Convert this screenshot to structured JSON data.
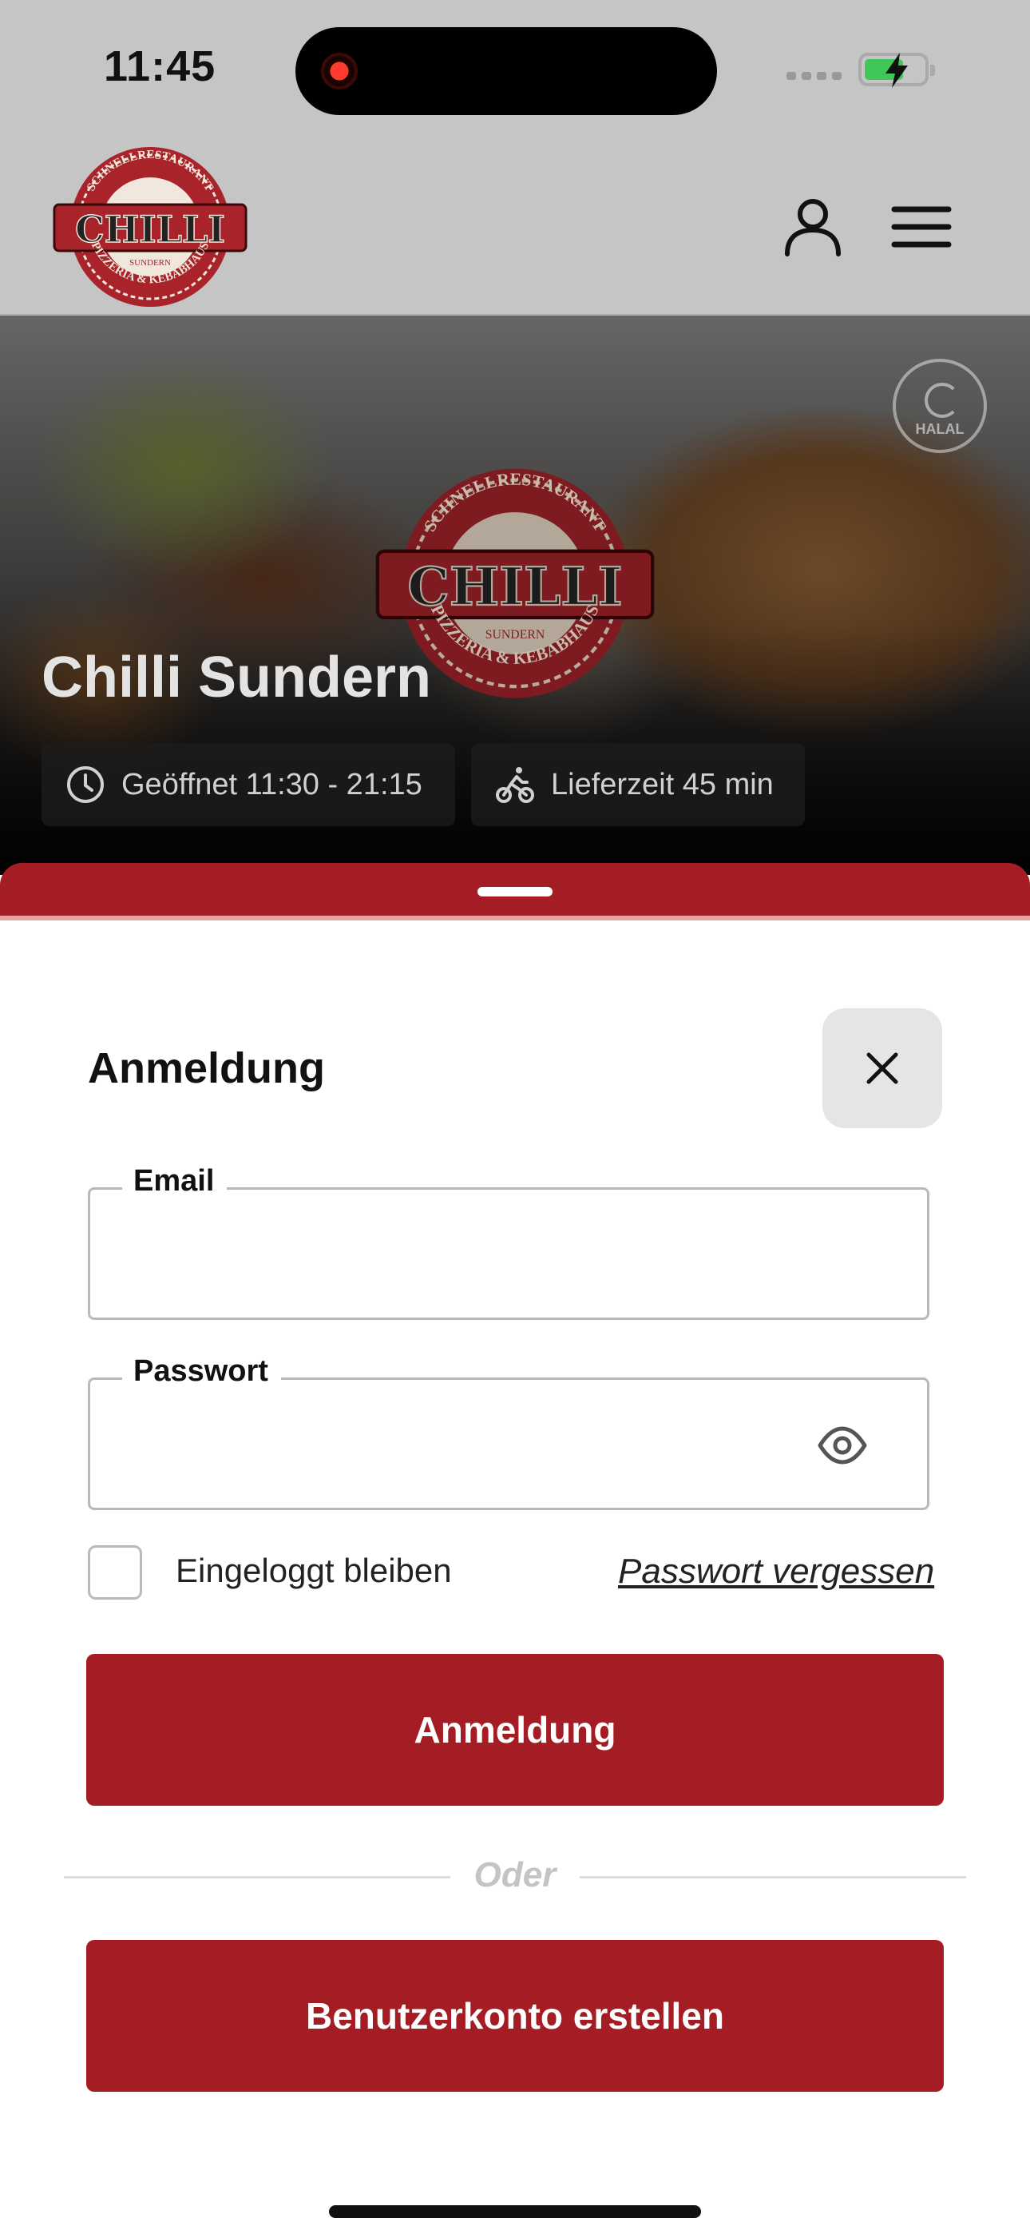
{
  "status_bar": {
    "time": "11:45",
    "recording_indicator": "red",
    "battery": {
      "charging": true,
      "level_fraction": 0.55,
      "color": "#40c759"
    }
  },
  "header": {
    "logo": {
      "top_text": "SCHNELLRESTAURANT",
      "main_text": "CHILLI",
      "middle_text": "SUNDERN",
      "bottom_text": "PIZZERIA & KEBABHAUS"
    },
    "icons": [
      "user-icon",
      "hamburger-menu-icon"
    ]
  },
  "hero": {
    "title": "Chilli Sundern",
    "badge_text": "HALAL",
    "opening_hours": "Geöffnet 11:30 - 21:15",
    "delivery_time": "Lieferzeit 45 min"
  },
  "login": {
    "title": "Anmeldung",
    "email_label": "Email",
    "email_value": "",
    "password_label": "Passwort",
    "password_value": "",
    "remember_label": "Eingeloggt bleiben",
    "remember_checked": false,
    "forgot_link": "Passwort vergessen",
    "submit_label": "Anmeldung",
    "divider_text": "Oder",
    "register_label": "Benutzerkonto erstellen"
  },
  "colors": {
    "brand_red": "#a51d24",
    "sheet_accent_line": "#e7a3a3",
    "overlay_gray": "#c5c5c5"
  }
}
